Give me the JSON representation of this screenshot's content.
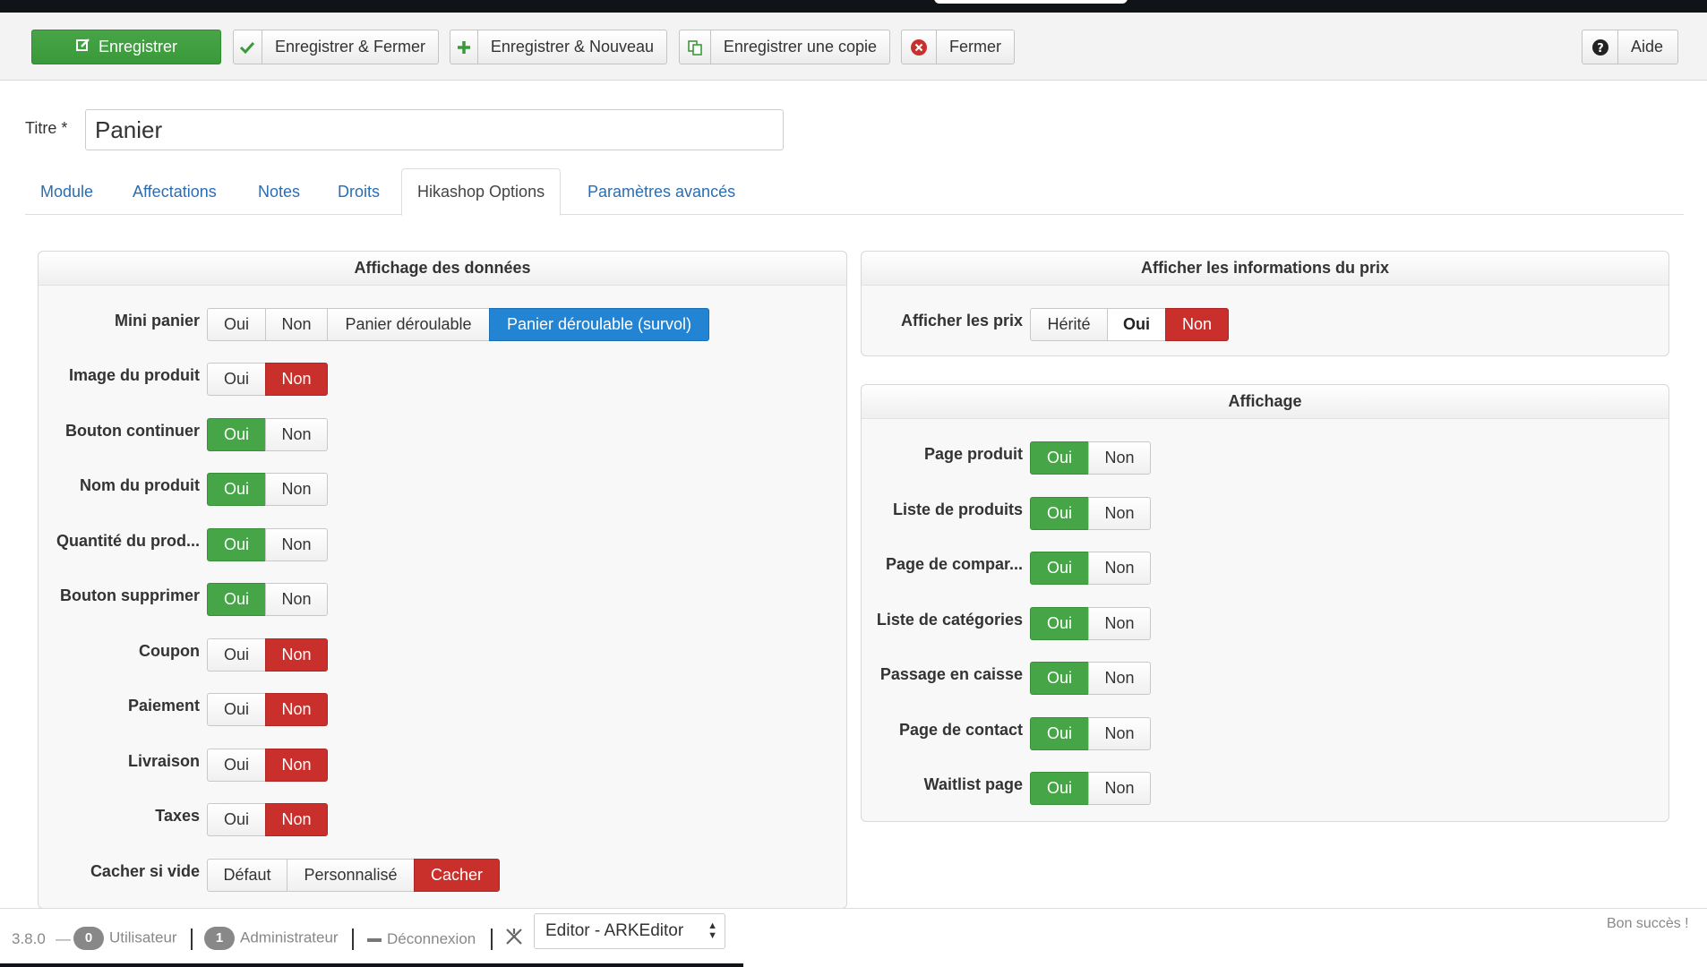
{
  "toolbar": {
    "save": "Enregistrer",
    "save_close": "Enregistrer & Fermer",
    "save_new": "Enregistrer & Nouveau",
    "save_copy": "Enregistrer une copie",
    "close": "Fermer",
    "help": "Aide"
  },
  "form": {
    "title_label": "Titre *",
    "title_value": "Panier"
  },
  "tabs": [
    "Module",
    "Affectations",
    "Notes",
    "Droits",
    "Hikashop Options",
    "Paramètres avancés"
  ],
  "active_tab": "Hikashop Options",
  "display_panel": {
    "title": "Affichage des données",
    "mini_cart": {
      "label": "Mini panier",
      "options": [
        "Oui",
        "Non",
        "Panier déroulable",
        "Panier déroulable (survol)"
      ],
      "selected": "Panier déroulable (survol)"
    },
    "rows": [
      {
        "label": "Image du produit",
        "options": [
          "Oui",
          "Non"
        ],
        "selected": "Non"
      },
      {
        "label": "Bouton continuer",
        "options": [
          "Oui",
          "Non"
        ],
        "selected": "Oui"
      },
      {
        "label": "Nom du produit",
        "options": [
          "Oui",
          "Non"
        ],
        "selected": "Oui"
      },
      {
        "label": "Quantité du prod...",
        "options": [
          "Oui",
          "Non"
        ],
        "selected": "Oui"
      },
      {
        "label": "Bouton supprimer",
        "options": [
          "Oui",
          "Non"
        ],
        "selected": "Oui"
      },
      {
        "label": "Coupon",
        "options": [
          "Oui",
          "Non"
        ],
        "selected": "Non"
      },
      {
        "label": "Paiement",
        "options": [
          "Oui",
          "Non"
        ],
        "selected": "Non"
      },
      {
        "label": "Livraison",
        "options": [
          "Oui",
          "Non"
        ],
        "selected": "Non"
      },
      {
        "label": "Taxes",
        "options": [
          "Oui",
          "Non"
        ],
        "selected": "Non"
      }
    ],
    "hide_empty": {
      "label": "Cacher si vide",
      "options": [
        "Défaut",
        "Personnalisé",
        "Cacher"
      ],
      "selected": "Cacher"
    }
  },
  "price_panel": {
    "title": "Afficher les informations du prix",
    "show_price": {
      "label": "Afficher les prix",
      "options": [
        "Hérité",
        "Oui",
        "Non"
      ],
      "selected": "Non",
      "emphasized": "Oui"
    }
  },
  "affichage_panel": {
    "title": "Affichage",
    "rows": [
      {
        "label": "Page produit",
        "options": [
          "Oui",
          "Non"
        ],
        "selected": "Oui"
      },
      {
        "label": "Liste de produits",
        "options": [
          "Oui",
          "Non"
        ],
        "selected": "Oui"
      },
      {
        "label": "Page de compar...",
        "options": [
          "Oui",
          "Non"
        ],
        "selected": "Oui"
      },
      {
        "label": "Liste de catégories",
        "options": [
          "Oui",
          "Non"
        ],
        "selected": "Oui"
      },
      {
        "label": "Passage en caisse",
        "options": [
          "Oui",
          "Non"
        ],
        "selected": "Oui"
      },
      {
        "label": "Page de contact",
        "options": [
          "Oui",
          "Non"
        ],
        "selected": "Oui"
      },
      {
        "label": "Waitlist page",
        "options": [
          "Oui",
          "Non"
        ],
        "selected": "Oui"
      }
    ]
  },
  "footer": {
    "version": "3.8.0",
    "dash": "—",
    "users_count": "0",
    "users_label": "Utilisateur",
    "admins_count": "1",
    "admins_label": "Administrateur",
    "logout": "Déconnexion",
    "editor_select": "Editor - ARKEditor",
    "right_text": "Bon succès !"
  },
  "colors": {
    "green": "#46a546",
    "red": "#c9302c",
    "blue": "#2384d3",
    "link": "#2a6db3"
  },
  "icons": {
    "save": "edit-icon",
    "save_close": "check-icon",
    "save_new": "plus-icon",
    "save_copy": "copy-icon",
    "close": "times-circle-icon",
    "help": "question-circle-icon",
    "logout": "minus-icon",
    "editor": "joomla-x-icon"
  }
}
